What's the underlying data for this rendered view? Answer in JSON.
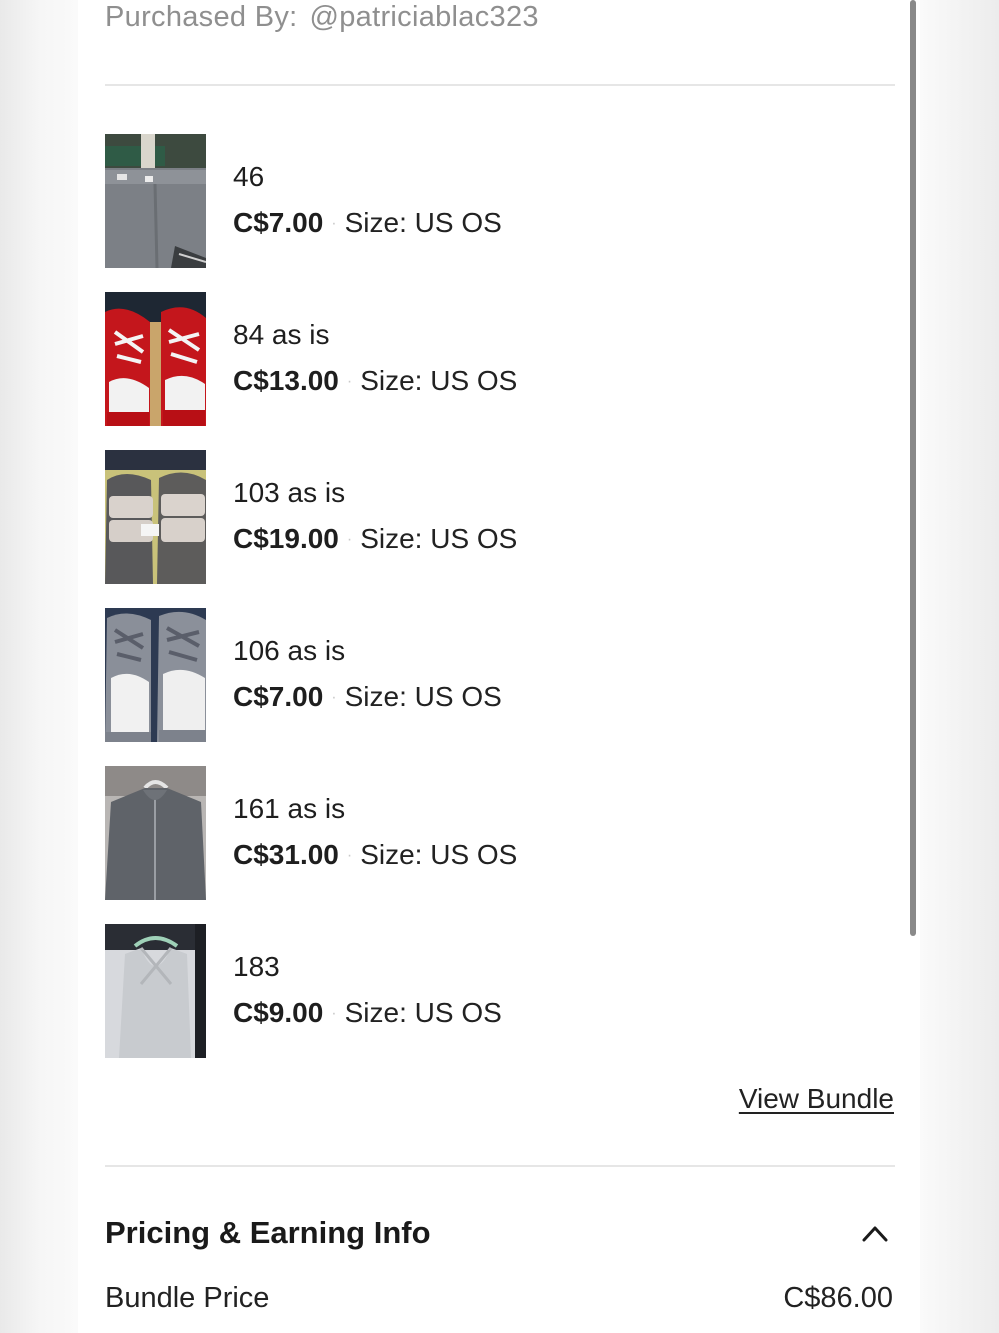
{
  "header": {
    "purchased_label": "Purchased By:",
    "purchased_handle": "@patriciablac323"
  },
  "items": [
    {
      "name": "46",
      "price": "C$7.00",
      "size": "Size: US OS",
      "thumb": "gray-shorts"
    },
    {
      "name": "84 as is",
      "price": "C$13.00",
      "size": "Size: US OS",
      "thumb": "red-sneakers"
    },
    {
      "name": "103 as is",
      "price": "C$19.00",
      "size": "Size: US OS",
      "thumb": "slide-sandals"
    },
    {
      "name": "106 as is",
      "price": "C$7.00",
      "size": "Size: US OS",
      "thumb": "gray-sneakers"
    },
    {
      "name": "161 as is",
      "price": "C$31.00",
      "size": "Size: US OS",
      "thumb": "gray-jacket"
    },
    {
      "name": "183",
      "price": "C$9.00",
      "size": "Size: US OS",
      "thumb": "tank-top"
    }
  ],
  "separator_glyph": "·",
  "view_bundle_label": "View Bundle",
  "pricing": {
    "title": "Pricing & Earning Info",
    "toggle_icon": "chevron-up-icon",
    "bundle_price_label": "Bundle Price",
    "bundle_price_value": "C$86.00"
  }
}
